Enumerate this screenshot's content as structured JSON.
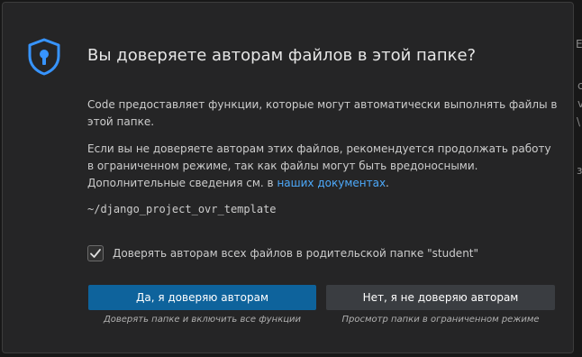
{
  "dialog": {
    "title": "Вы доверяете авторам файлов в этой папке?",
    "paragraph1": "Code предоставляет функции, которые могут автоматически выполнять файлы в этой папке.",
    "paragraph2_prefix": "Если вы не доверяете авторам этих файлов, рекомендуется продолжать работу в ограниченном режиме, так как файлы могут быть вредоносными. Дополнительные сведения см. в ",
    "paragraph2_link": "наших документах",
    "paragraph2_suffix": ".",
    "folder_path": "~/django_project_ovr_template",
    "checkbox_label": "Доверять авторам всех файлов в родительской папке \"student\"",
    "checkbox_checked": true,
    "trust_button": "Да, я доверяю авторам",
    "trust_caption": "Доверять папке и включить все функции",
    "distrust_button": "Нет, я не доверяю авторам",
    "distrust_caption": "Просмотр папки в ограниченном режиме"
  },
  "colors": {
    "accent": "#0e639c",
    "link": "#4daafc",
    "shield": "#3794ff"
  }
}
